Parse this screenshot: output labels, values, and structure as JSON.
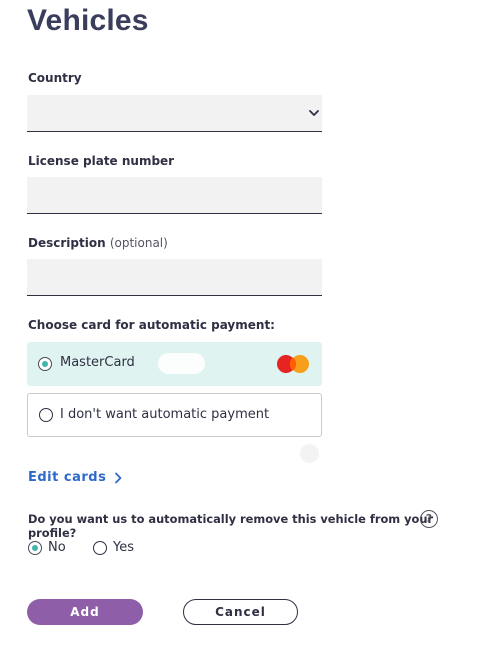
{
  "page": {
    "title": "Vehicles"
  },
  "form": {
    "country": {
      "label": "Country",
      "value": ""
    },
    "plate": {
      "label": "License plate number",
      "value": ""
    },
    "description": {
      "label": "Description",
      "optional": "(optional)",
      "value": ""
    }
  },
  "payment": {
    "heading": "Choose card for automatic payment:",
    "options": [
      {
        "label": "MasterCard",
        "selected": true,
        "icon": "mastercard-logo"
      },
      {
        "label": "I don't want automatic payment",
        "selected": false
      }
    ],
    "edit_link": "Edit cards",
    "edit_icon": "chevron-right-icon"
  },
  "auto_remove": {
    "question": "Do you want us to automatically remove this vehicle from your profile?",
    "help_icon": "?",
    "options": [
      {
        "label": "No",
        "selected": true
      },
      {
        "label": "Yes",
        "selected": false
      }
    ]
  },
  "actions": {
    "add_label": "Add",
    "cancel_label": "Cancel"
  },
  "colors": {
    "primary": "#8e5fa8",
    "link": "#2f69c9",
    "selected_bg": "#dff3f1",
    "radio_dot": "#44b5ad"
  }
}
